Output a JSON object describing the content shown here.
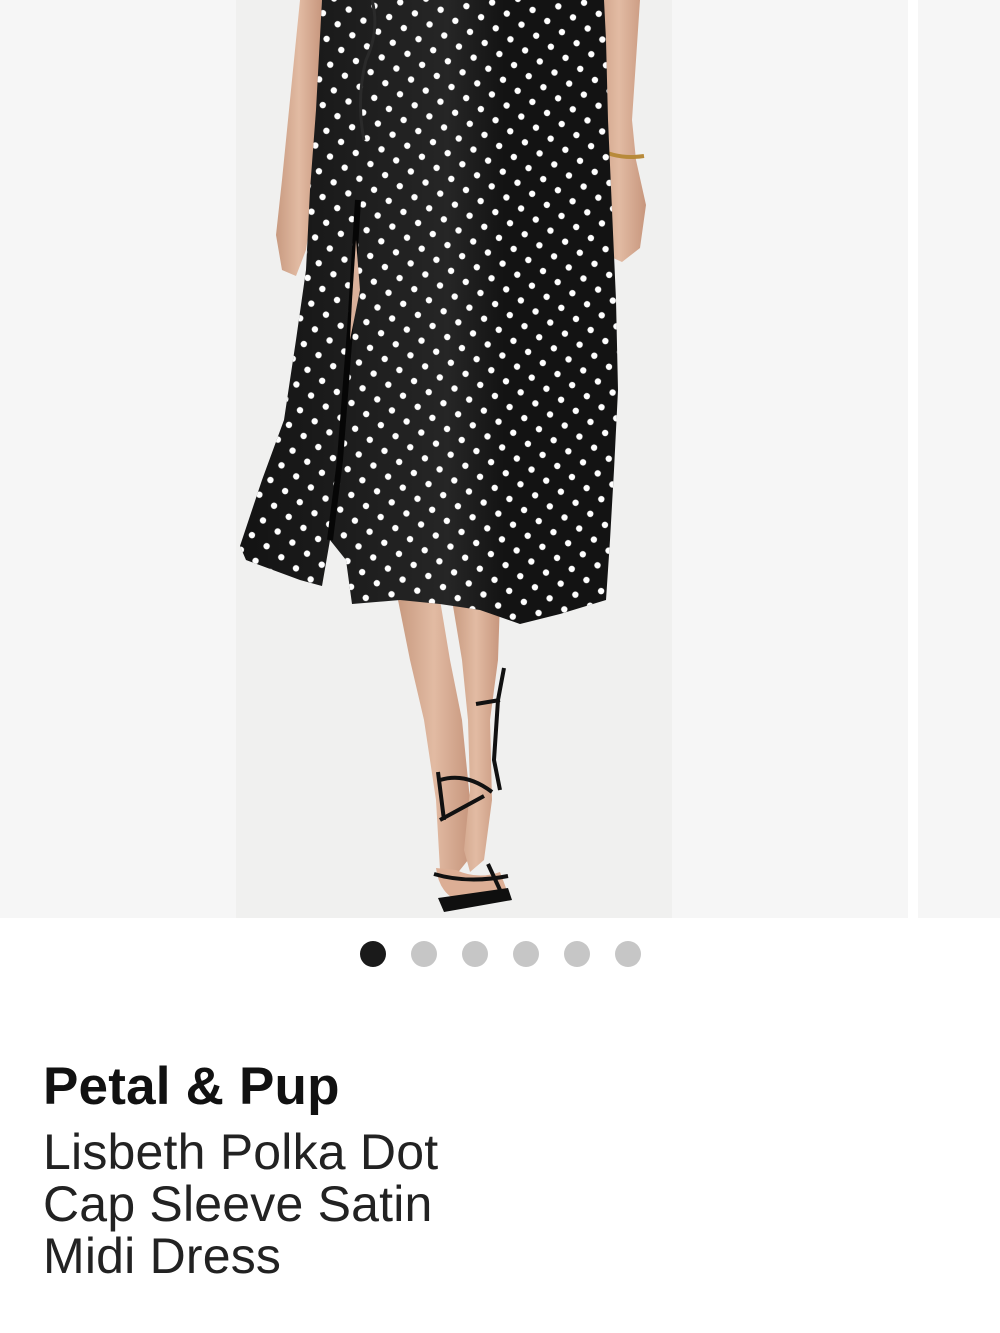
{
  "carousel": {
    "slide_count": 6,
    "active_index": 0,
    "dots": [
      {
        "active": true
      },
      {
        "active": false
      },
      {
        "active": false
      },
      {
        "active": false
      },
      {
        "active": false
      },
      {
        "active": false
      }
    ]
  },
  "product": {
    "brand": "Petal & Pup",
    "name": "Lisbeth Polka Dot Cap Sleeve Satin Midi Dress"
  },
  "colors": {
    "dot_active": "#1a1a1a",
    "dot_inactive": "#c6c6c6",
    "dress": "#131313",
    "polka_dot": "#ffffff",
    "image_background": "#f6f6f6"
  }
}
